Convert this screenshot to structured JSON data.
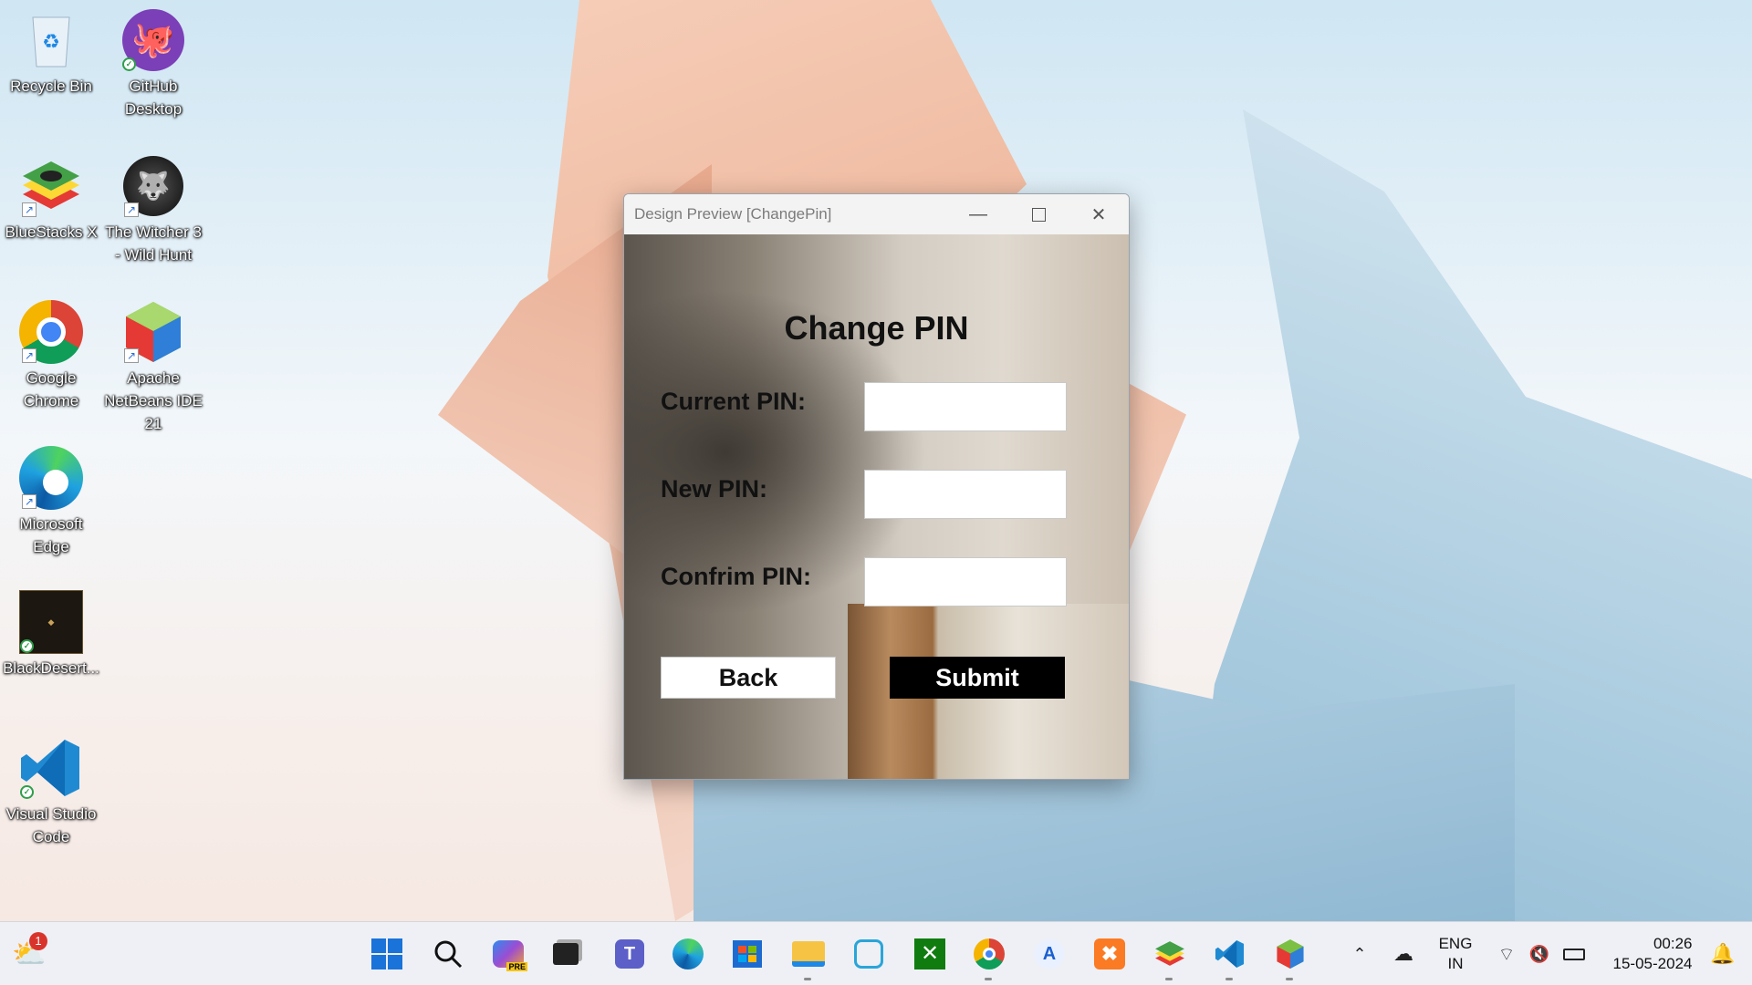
{
  "desktop": {
    "icons": [
      {
        "label": "Recycle Bin",
        "icon": "recycle-bin-icon"
      },
      {
        "label": "GitHub Desktop",
        "icon": "github-desktop-icon"
      },
      {
        "label": "BlueStacks X",
        "icon": "bluestacks-icon"
      },
      {
        "label": "The Witcher 3 - Wild Hunt",
        "icon": "witcher-icon"
      },
      {
        "label": "Google Chrome",
        "icon": "chrome-icon"
      },
      {
        "label": "Apache NetBeans IDE 21",
        "icon": "netbeans-icon"
      },
      {
        "label": "Microsoft Edge",
        "icon": "edge-icon"
      },
      {
        "label": "BlackDesert...",
        "icon": "blackdesert-icon"
      },
      {
        "label": "Visual Studio Code",
        "icon": "vscode-icon"
      }
    ]
  },
  "window": {
    "title": "Design Preview [ChangePin]",
    "heading": "Change PIN",
    "fields": [
      {
        "label": "Current PIN:",
        "value": ""
      },
      {
        "label": "New PIN:",
        "value": ""
      },
      {
        "label": "Confrim PIN:",
        "value": ""
      }
    ],
    "back_label": "Back",
    "submit_label": "Submit"
  },
  "taskbar": {
    "weather_badge": "1",
    "apps": [
      "start-icon",
      "search-icon",
      "copilot-icon",
      "task-view-icon",
      "teams-icon",
      "edge-icon",
      "store-icon",
      "file-explorer-icon",
      "app-icon",
      "xbox-icon",
      "chrome-icon",
      "translate-icon",
      "xampp-icon",
      "bluestacks-icon",
      "vscode-icon",
      "netbeans-icon"
    ],
    "language": "ENG",
    "region": "IN",
    "time": "00:26",
    "date": "15-05-2024"
  }
}
